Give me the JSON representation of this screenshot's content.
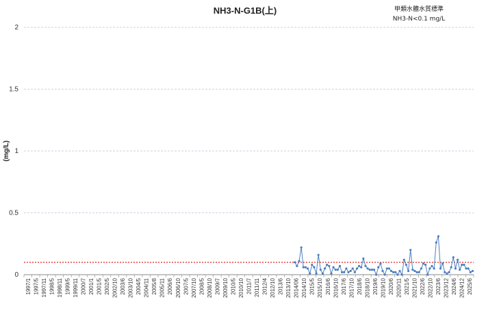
{
  "chart_data": {
    "type": "line",
    "title": "NH3-N-G1B(上)",
    "standard_note": [
      "甲類水體水質標準",
      "NH3-N<0.1 mg/L"
    ],
    "ylabel": "(mg/L)",
    "xlabel": "",
    "ylim": [
      0,
      2
    ],
    "y_ticks": [
      "0",
      "0.5",
      "1",
      "1.5",
      "2"
    ],
    "y_tick_values": [
      0,
      0.5,
      1,
      1.5,
      2
    ],
    "grid": "horizontal dashed",
    "legend": "none",
    "x_tick_labels": [
      "1997/1",
      "1997/5",
      "1997/11",
      "1998/5",
      "1998/11",
      "1999/5",
      "1999/11",
      "2000/7",
      "2001/1",
      "2001/5",
      "2002/5",
      "2002/10",
      "2003/6",
      "2003/10",
      "2004/5",
      "2004/11",
      "2005/8",
      "2005/11",
      "2006/6",
      "2006/10",
      "2007/5",
      "2007/10",
      "2008/5",
      "2008/10",
      "2009/7",
      "2009/10",
      "2010/5",
      "2010/10",
      "2011/7",
      "2011/11",
      "2012/4",
      "2012/10",
      "2013/6",
      "2013/10",
      "2014/06",
      "2014/10",
      "2015/5",
      "2015/10",
      "2016/6",
      "2016/10",
      "2017/6",
      "2017/10",
      "2018/6",
      "2018/10",
      "2019/6",
      "2019/10",
      "2020/6",
      "2020/11",
      "2021/5",
      "2021/10",
      "2022/6",
      "2022/10",
      "2023/6",
      "2023/12",
      "2024/6",
      "2024/12",
      "2025/6"
    ],
    "standard_line": {
      "value": 0.1,
      "color": "#e03030",
      "style": "dotted"
    },
    "series": [
      {
        "color": "#4a7fc0",
        "values": [
          null,
          null,
          null,
          null,
          null,
          null,
          null,
          null,
          null,
          null,
          null,
          null,
          null,
          null,
          null,
          null,
          null,
          null,
          null,
          null,
          null,
          null,
          null,
          null,
          null,
          null,
          null,
          null,
          null,
          null,
          null,
          null,
          null,
          null,
          null,
          null,
          null,
          null,
          null,
          null,
          null,
          null,
          null,
          null,
          null,
          null,
          null,
          null,
          null,
          null,
          null,
          null,
          null,
          null,
          null,
          null,
          null,
          null,
          null,
          null,
          null,
          null,
          null,
          null,
          null,
          null,
          null,
          null,
          null,
          null,
          null,
          null,
          null,
          null,
          null,
          null,
          null,
          null,
          null,
          null,
          null,
          null,
          null,
          null,
          null,
          null,
          null,
          null,
          null,
          null,
          null,
          null,
          null,
          null,
          null,
          null,
          null,
          null,
          null,
          null,
          null,
          null,
          null,
          null,
          null,
          null,
          null,
          null,
          null,
          null,
          null,
          null,
          null,
          null,
          null,
          null,
          null,
          null,
          null,
          null,
          null,
          null,
          null,
          null,
          null,
          null,
          0.1,
          0.07,
          0.11,
          0.22,
          0.06,
          0.06,
          0.05,
          0.01,
          0.08,
          0.06,
          0.01,
          0.16,
          0.04,
          0.01,
          0.05,
          0.08,
          0.07,
          0.01,
          0.06,
          0.04,
          0.04,
          0.07,
          0.02,
          0.02,
          0.05,
          0.02,
          0.03,
          0.05,
          0.02,
          0.05,
          0.07,
          0.06,
          0.13,
          0.07,
          0.05,
          0.04,
          0.04,
          0.04,
          0.0,
          0.06,
          0.09,
          0.03,
          0.0,
          0.05,
          0.05,
          0.03,
          0.02,
          0.02,
          0.0,
          0.03,
          0.0,
          0.12,
          0.08,
          0.03,
          0.2,
          0.04,
          0.03,
          0.02,
          0.02,
          0.05,
          0.09,
          0.08,
          0.0,
          0.05,
          0.07,
          0.05,
          0.26,
          0.31,
          0.05,
          0.09,
          0.02,
          0.01,
          0.02,
          0.06,
          0.14,
          0.05,
          0.12,
          0.04,
          0.08,
          0.08,
          0.05,
          0.05,
          0.02,
          0.03
        ]
      }
    ]
  }
}
